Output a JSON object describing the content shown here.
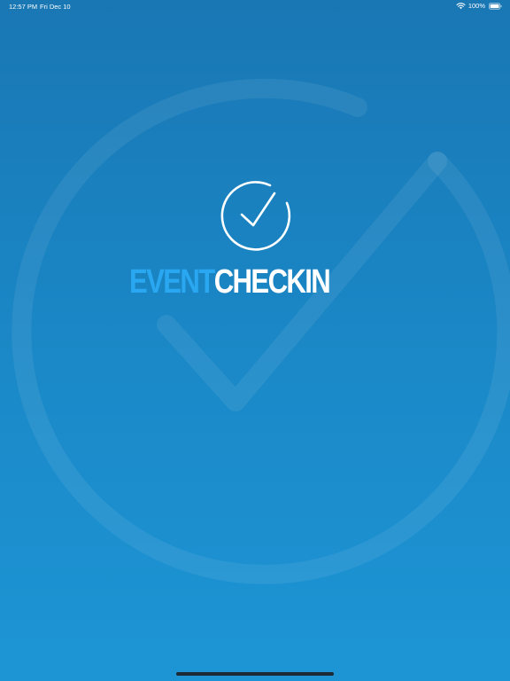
{
  "status_bar": {
    "time": "12:57 PM",
    "date": "Fri Dec 10",
    "battery_percent": "100%",
    "icons": [
      "wifi-icon",
      "battery-icon"
    ]
  },
  "brand": {
    "wordmark_part1": "EVENT",
    "wordmark_part2": "CHECKIN",
    "part1_color": "#2aa7f1",
    "part2_color": "#ffffff",
    "logo_icon": "check-circle-icon"
  },
  "background": {
    "gradient_top": "#1977b4",
    "gradient_bottom": "#1d95d5",
    "watermark_icon": "check-circle-watermark"
  }
}
